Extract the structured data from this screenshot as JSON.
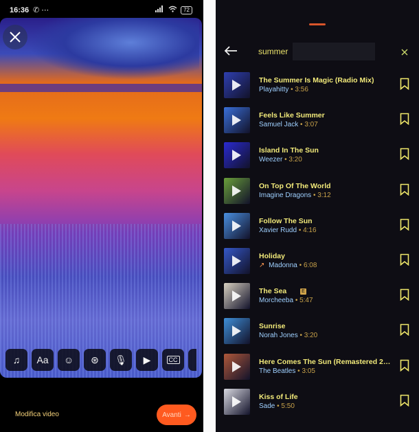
{
  "status_bar": {
    "time": "16:36",
    "battery": "72",
    "left_icons": "✆ ⋯"
  },
  "editor": {
    "edit_label": "Modifica video",
    "next_label": "Avanti",
    "tools": [
      {
        "name": "music-icon",
        "glyph": "♫"
      },
      {
        "name": "text-icon",
        "glyph": "Aa"
      },
      {
        "name": "sticker-icon",
        "glyph": "☺"
      },
      {
        "name": "effects-icon",
        "glyph": "⊛"
      },
      {
        "name": "mic-icon",
        "glyph": "🎙"
      },
      {
        "name": "add-clip-icon",
        "glyph": "▶"
      },
      {
        "name": "captions-icon",
        "glyph": "CC"
      }
    ]
  },
  "search": {
    "query": "summer"
  },
  "results": [
    {
      "title": "The Summer Is Magic (Radio Mix)",
      "artist": "Playahitty",
      "duration": "3:56",
      "trend": false,
      "explicit": false,
      "thumb": "#2f3fb0"
    },
    {
      "title": "Feels Like Summer",
      "artist": "Samuel Jack",
      "duration": "3:07",
      "trend": false,
      "explicit": false,
      "thumb": "#3a6fd8"
    },
    {
      "title": "Island In The Sun",
      "artist": "Weezer",
      "duration": "3:20",
      "trend": false,
      "explicit": false,
      "thumb": "#2a2ad0"
    },
    {
      "title": "On Top Of The World",
      "artist": "Imagine Dragons",
      "duration": "3:12",
      "trend": false,
      "explicit": false,
      "thumb": "#6a9f3a"
    },
    {
      "title": "Follow The Sun",
      "artist": "Xavier Rudd",
      "duration": "4:16",
      "trend": false,
      "explicit": false,
      "thumb": "#4a8fe0"
    },
    {
      "title": "Holiday",
      "artist": "Madonna",
      "duration": "6:08",
      "trend": true,
      "explicit": false,
      "thumb": "#3558c8"
    },
    {
      "title": "The Sea",
      "artist": "Morcheeba",
      "duration": "5:47",
      "trend": false,
      "explicit": true,
      "thumb": "#d8d0c0"
    },
    {
      "title": "Sunrise",
      "artist": "Norah Jones",
      "duration": "3:20",
      "trend": false,
      "explicit": false,
      "thumb": "#3f8fd8"
    },
    {
      "title": "Here Comes The Sun (Remastered 20…",
      "artist": "The Beatles",
      "duration": "3:05",
      "trend": false,
      "explicit": false,
      "thumb": "#b0583a"
    },
    {
      "title": "Kiss of Life",
      "artist": "Sade",
      "duration": "5:50",
      "trend": false,
      "explicit": false,
      "thumb": "#d8d8e0"
    }
  ],
  "colors": {
    "accent": "#ff5a1f",
    "title_text": "#f2ea7a",
    "meta_text": "#c8a24a"
  }
}
